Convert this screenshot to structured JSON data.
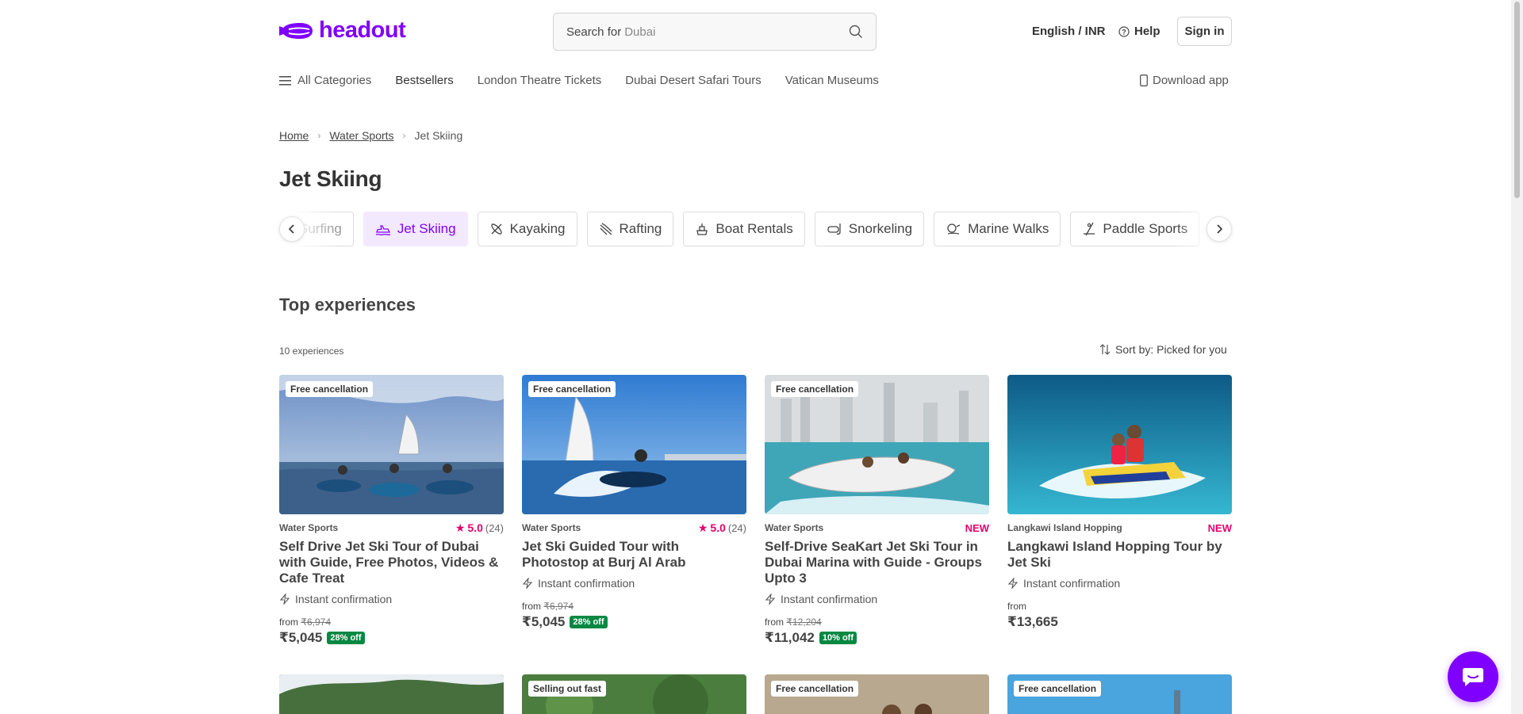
{
  "header": {
    "logo_text": "headout",
    "search_label": "Search for",
    "search_placeholder": "Dubai",
    "language": "English / INR",
    "help": "Help",
    "sign_in": "Sign in"
  },
  "nav": {
    "all_categories": "All Categories",
    "items": [
      "Bestsellers",
      "London Theatre Tickets",
      "Dubai Desert Safari Tours",
      "Vatican Museums"
    ],
    "download_app": "Download app"
  },
  "breadcrumb": [
    "Home",
    "Water Sports",
    "Jet Skiing"
  ],
  "page_title": "Jet Skiing",
  "categories": [
    {
      "label": "Surfing",
      "icon": "surfing-icon",
      "active": false
    },
    {
      "label": "Jet Skiing",
      "icon": "jet-ski-icon",
      "active": true
    },
    {
      "label": "Kayaking",
      "icon": "kayak-icon",
      "active": false
    },
    {
      "label": "Rafting",
      "icon": "rafting-icon",
      "active": false
    },
    {
      "label": "Boat Rentals",
      "icon": "boat-icon",
      "active": false
    },
    {
      "label": "Snorkeling",
      "icon": "snorkel-icon",
      "active": false
    },
    {
      "label": "Marine Walks",
      "icon": "marine-walk-icon",
      "active": false
    },
    {
      "label": "Paddle Sports",
      "icon": "paddle-icon",
      "active": false
    }
  ],
  "section": {
    "title": "Top experiences",
    "count": "10 experiences",
    "sort": "Sort by: Picked for you"
  },
  "cards": [
    {
      "badge": "Free cancellation",
      "category": "Water Sports",
      "rating": "5.0",
      "rating_count": "(24)",
      "tag": "",
      "title": "Self Drive Jet Ski Tour of Dubai with Guide, Free Photos, Videos & Cafe Treat",
      "instant": "Instant confirmation",
      "from": "from",
      "original_price": "₹6,974",
      "price": "₹5,045",
      "discount": "28% off"
    },
    {
      "badge": "Free cancellation",
      "category": "Water Sports",
      "rating": "5.0",
      "rating_count": "(24)",
      "tag": "",
      "title": "Jet Ski Guided Tour with Photostop at Burj Al Arab",
      "instant": "Instant confirmation",
      "from": "from",
      "original_price": "₹6,974",
      "price": "₹5,045",
      "discount": "28% off"
    },
    {
      "badge": "Free cancellation",
      "category": "Water Sports",
      "rating": "",
      "rating_count": "",
      "tag": "NEW",
      "title": "Self-Drive SeaKart Jet Ski Tour in Dubai Marina with Guide  - Groups Upto 3",
      "instant": "Instant confirmation",
      "from": "from",
      "original_price": "₹12,204",
      "price": "₹11,042",
      "discount": "10% off"
    },
    {
      "badge": "",
      "category": "Langkawi Island Hopping",
      "rating": "",
      "rating_count": "",
      "tag": "NEW",
      "title": "Langkawi Island Hopping Tour by Jet Ski",
      "instant": "Instant confirmation",
      "from": "from",
      "original_price": "",
      "price": "₹13,665",
      "discount": ""
    }
  ],
  "row2_badges": [
    "",
    "Selling out fast",
    "Free cancellation",
    "Free cancellation"
  ],
  "colors": {
    "brand": "#8000ff",
    "rating": "#e5006e",
    "discount": "#078842"
  }
}
